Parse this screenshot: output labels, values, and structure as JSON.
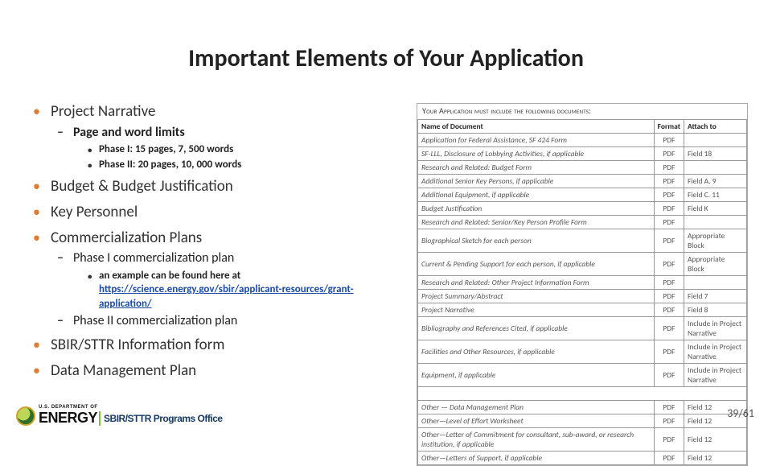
{
  "title": "Important Elements of Your Application",
  "bullets": {
    "projectNarrative": "Project Narrative",
    "pageWordLimits": "Page and word limits",
    "phase1limit": "Phase I:  15 pages, 7, 500 words",
    "phase2limit": "Phase II:  20 pages, 10, 000 words",
    "budget": "Budget  & Budget Justification",
    "keyPersonnel": "Key Personnel",
    "commercialization": "Commercialization Plans",
    "phase1plan": "Phase I commercialization plan",
    "exampleIntro": "an example can be found here at ",
    "exampleLink": "https://science.energy.gov/sbir/applicant-resources/grant-application/",
    "phase2plan": "Phase II commercialization plan",
    "infoForm": "SBIR/STTR Information form",
    "dmp": "Data Management Plan"
  },
  "table": {
    "caption": "Your Application must include the following documents:",
    "headers": [
      "Name of Document",
      "Format",
      "Attach to"
    ],
    "rows": [
      [
        "Application for Federal Assistance, SF 424 Form",
        "PDF",
        ""
      ],
      [
        "SF-LLL, Disclosure of Lobbying Activities, if applicable",
        "PDF",
        "Field 18"
      ],
      [
        "Research and Related: Budget Form",
        "PDF",
        ""
      ],
      [
        "Additional Senior Key Persons, if applicable",
        "PDF",
        "Field A. 9"
      ],
      [
        "Additional Equipment, if applicable",
        "PDF",
        "Field C. 11"
      ],
      [
        "Budget Justification",
        "PDF",
        "Field K"
      ],
      [
        "Research and Related: Senior/Key Person Profile Form",
        "PDF",
        ""
      ],
      [
        "Biographical Sketch for each person",
        "PDF",
        "Appropriate Block"
      ],
      [
        "Current & Pending Support for each person, if applicable",
        "PDF",
        "Appropriate Block"
      ],
      [
        "Research and Related: Other Project Information Form",
        "PDF",
        ""
      ],
      [
        "Project Summary/Abstract",
        "PDF",
        "Field 7"
      ],
      [
        "Project Narrative",
        "PDF",
        "Field 8"
      ],
      [
        "Bibliography and References Cited, if applicable",
        "PDF",
        "Include in Project Narrative"
      ],
      [
        "Facilities and Other Resources, if applicable",
        "PDF",
        "Include in Project Narrative"
      ],
      [
        "Equipment, if applicable",
        "PDF",
        "Include in Project Narrative"
      ]
    ],
    "otherRows": [
      [
        "Other — Data Management Plan",
        "PDF",
        "Field 12"
      ],
      [
        "Other—Level of Effort Worksheet",
        "PDF",
        "Field 12"
      ],
      [
        "Other—Letter of Commitment for consultant, sub-award, or research institution, if applicable",
        "PDF",
        "Field 12"
      ],
      [
        "Other—Letters of Support, if applicable",
        "PDF",
        "Field 12"
      ]
    ]
  },
  "footer": {
    "dept": "U.S. DEPARTMENT OF",
    "energy": "ENERGY",
    "program": "SBIR/STTR Programs Office",
    "page": "39/61"
  }
}
